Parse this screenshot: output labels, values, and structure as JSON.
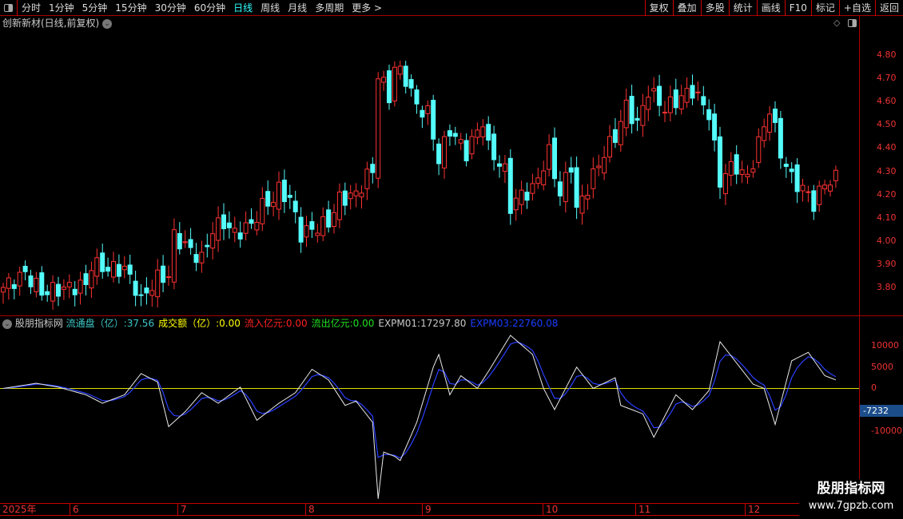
{
  "toolbar": {
    "periods": [
      "分时",
      "1分钟",
      "5分钟",
      "15分钟",
      "30分钟",
      "60分钟",
      "日线",
      "周线",
      "月线",
      "多周期",
      "更多 >"
    ],
    "active": "日线",
    "right_buttons": [
      "复权",
      "叠加",
      "多股",
      "统计",
      "画线",
      "F10",
      "标记",
      "+自选",
      "返回"
    ]
  },
  "chart_title": "创新新材(日线,前复权)",
  "price_axis": {
    "labels": [
      "4.80",
      "4.70",
      "4.60",
      "4.50",
      "4.40",
      "4.30",
      "4.20",
      "4.10",
      "4.00",
      "3.90",
      "3.80"
    ],
    "ylim": [
      3.69,
      4.9
    ]
  },
  "candles": {
    "up_color": "#ff3232",
    "down_color": "#54fcfc",
    "count": 152,
    "keypoints": [
      [
        0,
        3.8
      ],
      [
        4,
        3.86
      ],
      [
        7,
        3.78
      ],
      [
        12,
        3.8
      ],
      [
        15,
        3.81
      ],
      [
        16,
        3.9
      ],
      [
        19,
        3.88
      ],
      [
        22,
        3.88
      ],
      [
        24,
        3.8
      ],
      [
        25,
        3.74
      ],
      [
        26,
        3.78
      ],
      [
        28,
        3.84
      ],
      [
        30,
        3.85
      ],
      [
        31,
        4.02
      ],
      [
        33,
        3.98
      ],
      [
        36,
        3.92
      ],
      [
        38,
        4.05
      ],
      [
        40,
        4.08
      ],
      [
        42,
        4.03
      ],
      [
        45,
        4.07
      ],
      [
        47,
        4.15
      ],
      [
        49,
        4.18
      ],
      [
        50,
        4.22
      ],
      [
        52,
        4.18
      ],
      [
        54,
        4.03
      ],
      [
        57,
        4.06
      ],
      [
        59,
        4.08
      ],
      [
        61,
        4.18
      ],
      [
        64,
        4.2
      ],
      [
        66,
        4.28
      ],
      [
        67,
        4.3
      ],
      [
        68,
        4.72
      ],
      [
        70,
        4.62
      ],
      [
        71,
        4.75
      ],
      [
        73,
        4.7
      ],
      [
        75,
        4.58
      ],
      [
        77,
        4.55
      ],
      [
        79,
        4.35
      ],
      [
        81,
        4.48
      ],
      [
        84,
        4.38
      ],
      [
        87,
        4.52
      ],
      [
        88,
        4.4
      ],
      [
        91,
        4.3
      ],
      [
        92,
        4.15
      ],
      [
        94,
        4.2
      ],
      [
        96,
        4.22
      ],
      [
        99,
        4.38
      ],
      [
        101,
        4.2
      ],
      [
        103,
        4.33
      ],
      [
        104,
        4.13
      ],
      [
        107,
        4.28
      ],
      [
        109,
        4.38
      ],
      [
        111,
        4.45
      ],
      [
        113,
        4.58
      ],
      [
        115,
        4.5
      ],
      [
        117,
        4.65
      ],
      [
        120,
        4.57
      ],
      [
        123,
        4.62
      ],
      [
        125,
        4.65
      ],
      [
        128,
        4.55
      ],
      [
        130,
        4.25
      ],
      [
        131,
        4.3
      ],
      [
        133,
        4.32
      ],
      [
        135,
        4.27
      ],
      [
        137,
        4.42
      ],
      [
        139,
        4.57
      ],
      [
        141,
        4.38
      ],
      [
        143,
        4.27
      ],
      [
        146,
        4.2
      ],
      [
        147,
        4.16
      ],
      [
        149,
        4.25
      ],
      [
        151,
        4.27
      ]
    ]
  },
  "indicator": {
    "name": "股朋指标网",
    "fields": [
      {
        "label": "流通盘（亿）:",
        "value": "37.56",
        "color": "#3cc8c8"
      },
      {
        "label": "成交额（亿）:",
        "value": "0.00",
        "color": "#ffff00"
      },
      {
        "label": "流入亿元:",
        "value": "0.00",
        "color": "#ff2020"
      },
      {
        "label": "流出亿元:",
        "value": "0.00",
        "color": "#20e020"
      },
      {
        "label": "EXPM01:",
        "value": "17297.80",
        "color": "#c8c8c8"
      },
      {
        "label": "EXPM03:",
        "value": "22760.08",
        "color": "#1a3cff"
      }
    ],
    "axis_labels": [
      "10000",
      "5000",
      "0",
      "-10000"
    ],
    "current_tag": "-7232",
    "ylim": [
      -27000,
      14000
    ],
    "blue_ema_period": 3,
    "white_keypoints": [
      [
        0,
        0
      ],
      [
        6,
        1200
      ],
      [
        10,
        300
      ],
      [
        15,
        -1500
      ],
      [
        18,
        -3500
      ],
      [
        22,
        -1500
      ],
      [
        25,
        3500
      ],
      [
        28,
        1500
      ],
      [
        30,
        -9000
      ],
      [
        33,
        -5500
      ],
      [
        36,
        -1000
      ],
      [
        39,
        -3500
      ],
      [
        43,
        300
      ],
      [
        46,
        -7500
      ],
      [
        50,
        -3500
      ],
      [
        53,
        -1000
      ],
      [
        56,
        4500
      ],
      [
        59,
        2000
      ],
      [
        62,
        -4000
      ],
      [
        64,
        -3000
      ],
      [
        67,
        -8000
      ],
      [
        68,
        -26000
      ],
      [
        69,
        -15000
      ],
      [
        71,
        -16000
      ],
      [
        72,
        -17000
      ],
      [
        75,
        -8000
      ],
      [
        78,
        5000
      ],
      [
        79,
        8000
      ],
      [
        81,
        -1500
      ],
      [
        83,
        3000
      ],
      [
        86,
        0
      ],
      [
        88,
        4000
      ],
      [
        92,
        12500
      ],
      [
        96,
        8000
      ],
      [
        98,
        0
      ],
      [
        100,
        -5000
      ],
      [
        104,
        5000
      ],
      [
        107,
        0
      ],
      [
        111,
        2500
      ],
      [
        112,
        -4000
      ],
      [
        116,
        -6000
      ],
      [
        118,
        -11500
      ],
      [
        122,
        -1500
      ],
      [
        125,
        -5000
      ],
      [
        128,
        -500
      ],
      [
        130,
        11000
      ],
      [
        133,
        6000
      ],
      [
        136,
        1000
      ],
      [
        138,
        0
      ],
      [
        140,
        -8500
      ],
      [
        143,
        6500
      ],
      [
        146,
        8500
      ],
      [
        149,
        3000
      ],
      [
        151,
        2000
      ]
    ]
  },
  "date_axis": [
    "2025年",
    "6",
    "7",
    "8",
    "9",
    "10",
    "11",
    "12"
  ],
  "watermark": {
    "name": "股朋指标网",
    "url": "www.7gpzb.com"
  }
}
